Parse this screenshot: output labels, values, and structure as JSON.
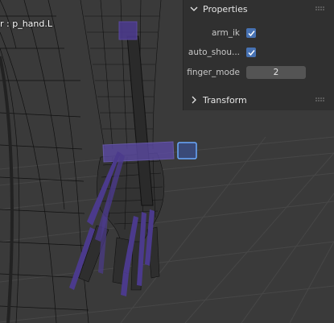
{
  "viewport": {
    "overlay_text": "r : p_hand.L",
    "background": "#3a3a3a",
    "wire_color": "#000000",
    "bone_color": "#4b3a8c",
    "active_bone_color": "#6aa9ff"
  },
  "npanel": {
    "properties_header": "Properties",
    "transform_header": "Transform",
    "properties": [
      {
        "label": "arm_ik",
        "type": "checkbox",
        "checked": true
      },
      {
        "label": "auto_shou...",
        "type": "checkbox",
        "checked": true
      },
      {
        "label": "finger_mode",
        "type": "number",
        "value": "2"
      }
    ]
  }
}
